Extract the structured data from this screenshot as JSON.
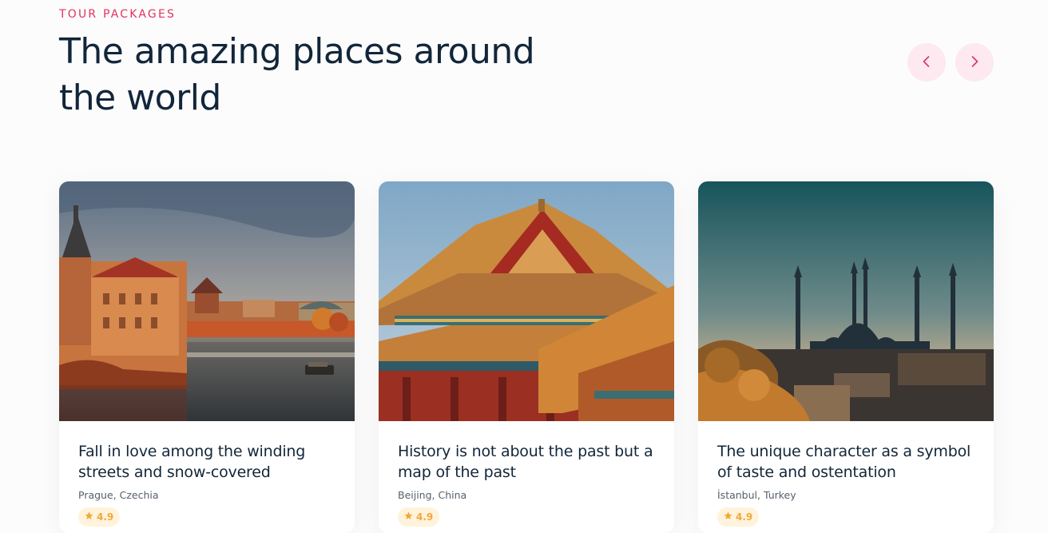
{
  "section": {
    "eyebrow": "TOUR PACKAGES",
    "title": "The amazing places around the world"
  },
  "nav": {
    "prev_icon": "chevron-left-icon",
    "next_icon": "chevron-right-icon"
  },
  "colors": {
    "accent": "#e0335f",
    "nav_bg": "#fde9ef",
    "title": "#12263a",
    "rating": "#f2a83b",
    "rating_bg": "#fff3dc"
  },
  "cards": [
    {
      "title": "Fall in love among the winding streets and snow-covered",
      "location": "Prague, Czechia",
      "rating": "4.9",
      "image": "prague-river-photo"
    },
    {
      "title": "History is not about the past but a map of the past",
      "location": "Beijing, China",
      "rating": "4.9",
      "image": "forbidden-city-roof-photo"
    },
    {
      "title": "The unique character as a symbol of taste and ostentation",
      "location": "İstanbul, Turkey",
      "rating": "4.9",
      "image": "istanbul-mosque-photo"
    }
  ]
}
